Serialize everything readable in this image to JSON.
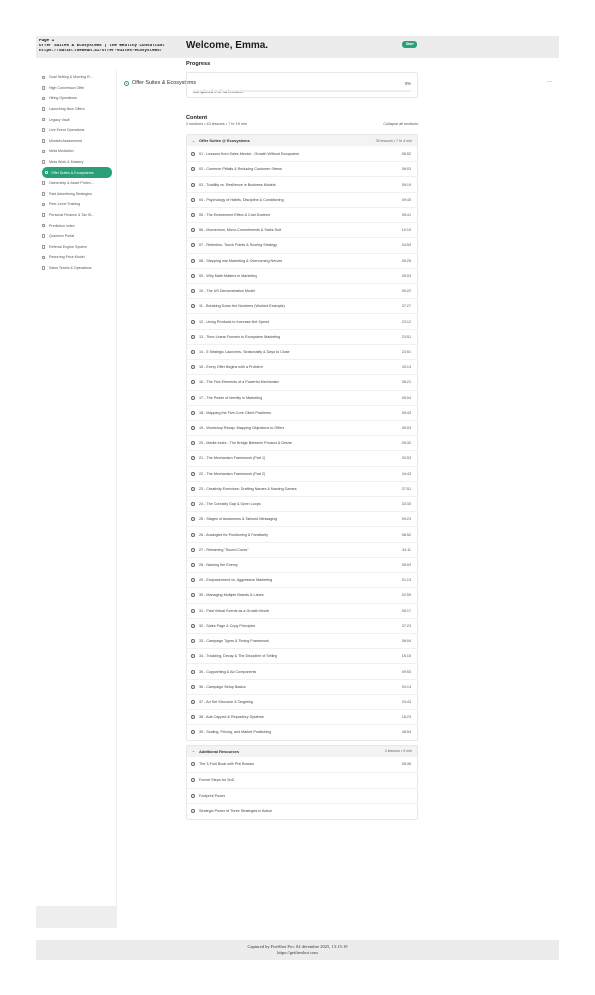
{
  "capture": {
    "header_line1": "Page 1",
    "header_line2": "Offer Suites & Ecosystems | the Wealthy Consultant",
    "header_line3": "https://watch.thedean.ai/offer-suites-ecosystems/",
    "footer_line1": "Captured by FireShot Pro: 02 décembre 2025, 13:15:19",
    "footer_line2": "https://getfireshot.com"
  },
  "sidebar": {
    "items": [
      {
        "label": "Goal Setting & Morning R...",
        "active": false
      },
      {
        "label": "High Conversion Offer",
        "active": false
      },
      {
        "label": "Hiring Operations",
        "active": false
      },
      {
        "label": "Launching New Offers",
        "active": false
      },
      {
        "label": "Legacy Vault",
        "active": false
      },
      {
        "label": "Live Event Operations",
        "active": false
      },
      {
        "label": "Mindset Assessment",
        "active": false
      },
      {
        "label": "Meta Mediation",
        "active": false
      },
      {
        "label": "Meta Work & Mastery",
        "active": false
      },
      {
        "label": "Offer Suites & Ecosystems",
        "active": true
      },
      {
        "label": "Ownership & Asset Protec...",
        "active": false
      },
      {
        "label": "Paid Advertising Strategies",
        "active": false
      },
      {
        "label": "Peer-Level Training",
        "active": false
      },
      {
        "label": "Personal Finance & Tax St...",
        "active": false
      },
      {
        "label": "Prediction Index",
        "active": false
      },
      {
        "label": "Quantum Portal",
        "active": false
      },
      {
        "label": "Referral Engine System",
        "active": false
      },
      {
        "label": "Recurring Price Model",
        "active": false
      },
      {
        "label": "Sales Teams & Operations",
        "active": false
      }
    ],
    "more": "."
  },
  "topbar": {
    "title": "Offer Suites & Ecosystems",
    "more": "..."
  },
  "main": {
    "welcome": "Welcome, Emma.",
    "badge": "Start",
    "progress_heading": "Progress",
    "progress_text": "Completed 0 of 43 lessons",
    "progress_pct_label": "0%",
    "progress_fraction": 0,
    "content_heading": "Content",
    "content_meta": "2 sections • 43 lessons • 7 hr 19 min",
    "collapse_label": "Collapse all sections"
  },
  "sections": [
    {
      "title": "Offer Suites @ Ecosystems",
      "meta": "39 lessons • 7 hr 4 min",
      "lessons": [
        {
          "title": "01 - Lessons from Sales Mentor - Growth Without Ecosystem",
          "duration": "08:52"
        },
        {
          "title": "02 - Common Pitfalls & Reducing Customer Stress",
          "duration": "08:03"
        },
        {
          "title": "03 - Tradility vs. Resilience in Business Models",
          "duration": "05:19"
        },
        {
          "title": "04 - Psychology of Habits, Discipline & Conditioning",
          "duration": "09:45"
        },
        {
          "title": "05 - The Endowment Effect & Cost Doctrine",
          "duration": "05:41"
        },
        {
          "title": "06 - Momentum, Micro-Commitments & Sales Suit",
          "duration": "10:15"
        },
        {
          "title": "07 - Retention, Touch Points & Scoring Strategy",
          "duration": "04:53"
        },
        {
          "title": "08 - Stepping into Marketing & Overcoming Nerves",
          "duration": "05:25"
        },
        {
          "title": "09 - Why Math Matters in Marketing",
          "duration": "05:03"
        },
        {
          "title": "10 - The US Demonstration Model",
          "duration": "05:22"
        },
        {
          "title": "11 - Breaking Down the Numbers (Worked Example)",
          "duration": "37:27"
        },
        {
          "title": "12 - Using Products to Increase Net Spend",
          "duration": "23:12"
        },
        {
          "title": "13 - Time-Linear Funnels to Ecosystem Marketing",
          "duration": "23:51"
        },
        {
          "title": "14 - 5 Strategic Launches, Seasonality & Days to Close",
          "duration": "23:51"
        },
        {
          "title": "15 - Every Offer Begins with a Problem",
          "duration": "43:13"
        },
        {
          "title": "16 - The Five Elements of a Powerful Mechanism",
          "duration": "38:21"
        },
        {
          "title": "17 - The Power of Identity in Marketing",
          "duration": "05:04"
        },
        {
          "title": "18 - Mapping the Five-Core Client Problems",
          "duration": "05:43"
        },
        {
          "title": "19 - Workshop Recap: Mapping Objections to Offers",
          "duration": "40:03"
        },
        {
          "title": "20 - Media Index - The Bridge Between Product & Desire",
          "duration": "05:32"
        },
        {
          "title": "21 - The Mechanism Framework (Part 1)",
          "duration": "33:53"
        },
        {
          "title": "22 - The Mechanism Framework (Part 2)",
          "duration": "44:43"
        },
        {
          "title": "23 - Creativity Exercises: Drafting Names & Naming Games",
          "duration": "37:51"
        },
        {
          "title": "24 - The Curiosity Gap & Open Loops",
          "duration": "33:33"
        },
        {
          "title": "25 - Stages of Awareness & Tailored Messaging",
          "duration": "09:23"
        },
        {
          "title": "26 - Analogies for Positioning & Familiarity",
          "duration": "08:52"
        },
        {
          "title": "27 - Reframing \"Sound Cures\"",
          "duration": "34:11"
        },
        {
          "title": "28 - Naming the Enemy",
          "duration": "05:03"
        },
        {
          "title": "29 - Empowerment vs. Aggressive Marketing",
          "duration": "21:13"
        },
        {
          "title": "30 - Managing Multiple Brands & Lanes",
          "duration": "02:59"
        },
        {
          "title": "31 - Paid Virtual Events as a Growth Model",
          "duration": "05:17"
        },
        {
          "title": "32 - Sales Page & Copy Principles",
          "duration": "37:23"
        },
        {
          "title": "33 - Campaign Types & Timing Framework",
          "duration": "08:04"
        },
        {
          "title": "34 - Trackling, Decay & The Discipline of Selling",
          "duration": "16:15"
        },
        {
          "title": "35 - Copywriting & Ad Components",
          "duration": "09:53"
        },
        {
          "title": "36 - Campaign Setup Basics",
          "duration": "04:14"
        },
        {
          "title": "37 - Ad Set Structure & Targeting",
          "duration": "03:43"
        },
        {
          "title": "38 - Ads Capped & Repository Systems",
          "duration": "18:23"
        },
        {
          "title": "39 - Scaling, Pricing, and Market Positioning",
          "duration": "48:54"
        }
      ]
    },
    {
      "title": "Additional Resources",
      "meta": "4 lessons • 0 min",
      "lessons": [
        {
          "title": "The 3-Fold Book with Phil Bowser",
          "duration": "08:36"
        },
        {
          "title": "Funnel Steps for SoD",
          "duration": ""
        },
        {
          "title": "Footprint Power",
          "duration": ""
        },
        {
          "title": "Strategic Power of Three Strategies in Action",
          "duration": ""
        }
      ]
    }
  ],
  "colors": {
    "accent": "#2aa07a",
    "panel_gray": "#eeeeee"
  }
}
